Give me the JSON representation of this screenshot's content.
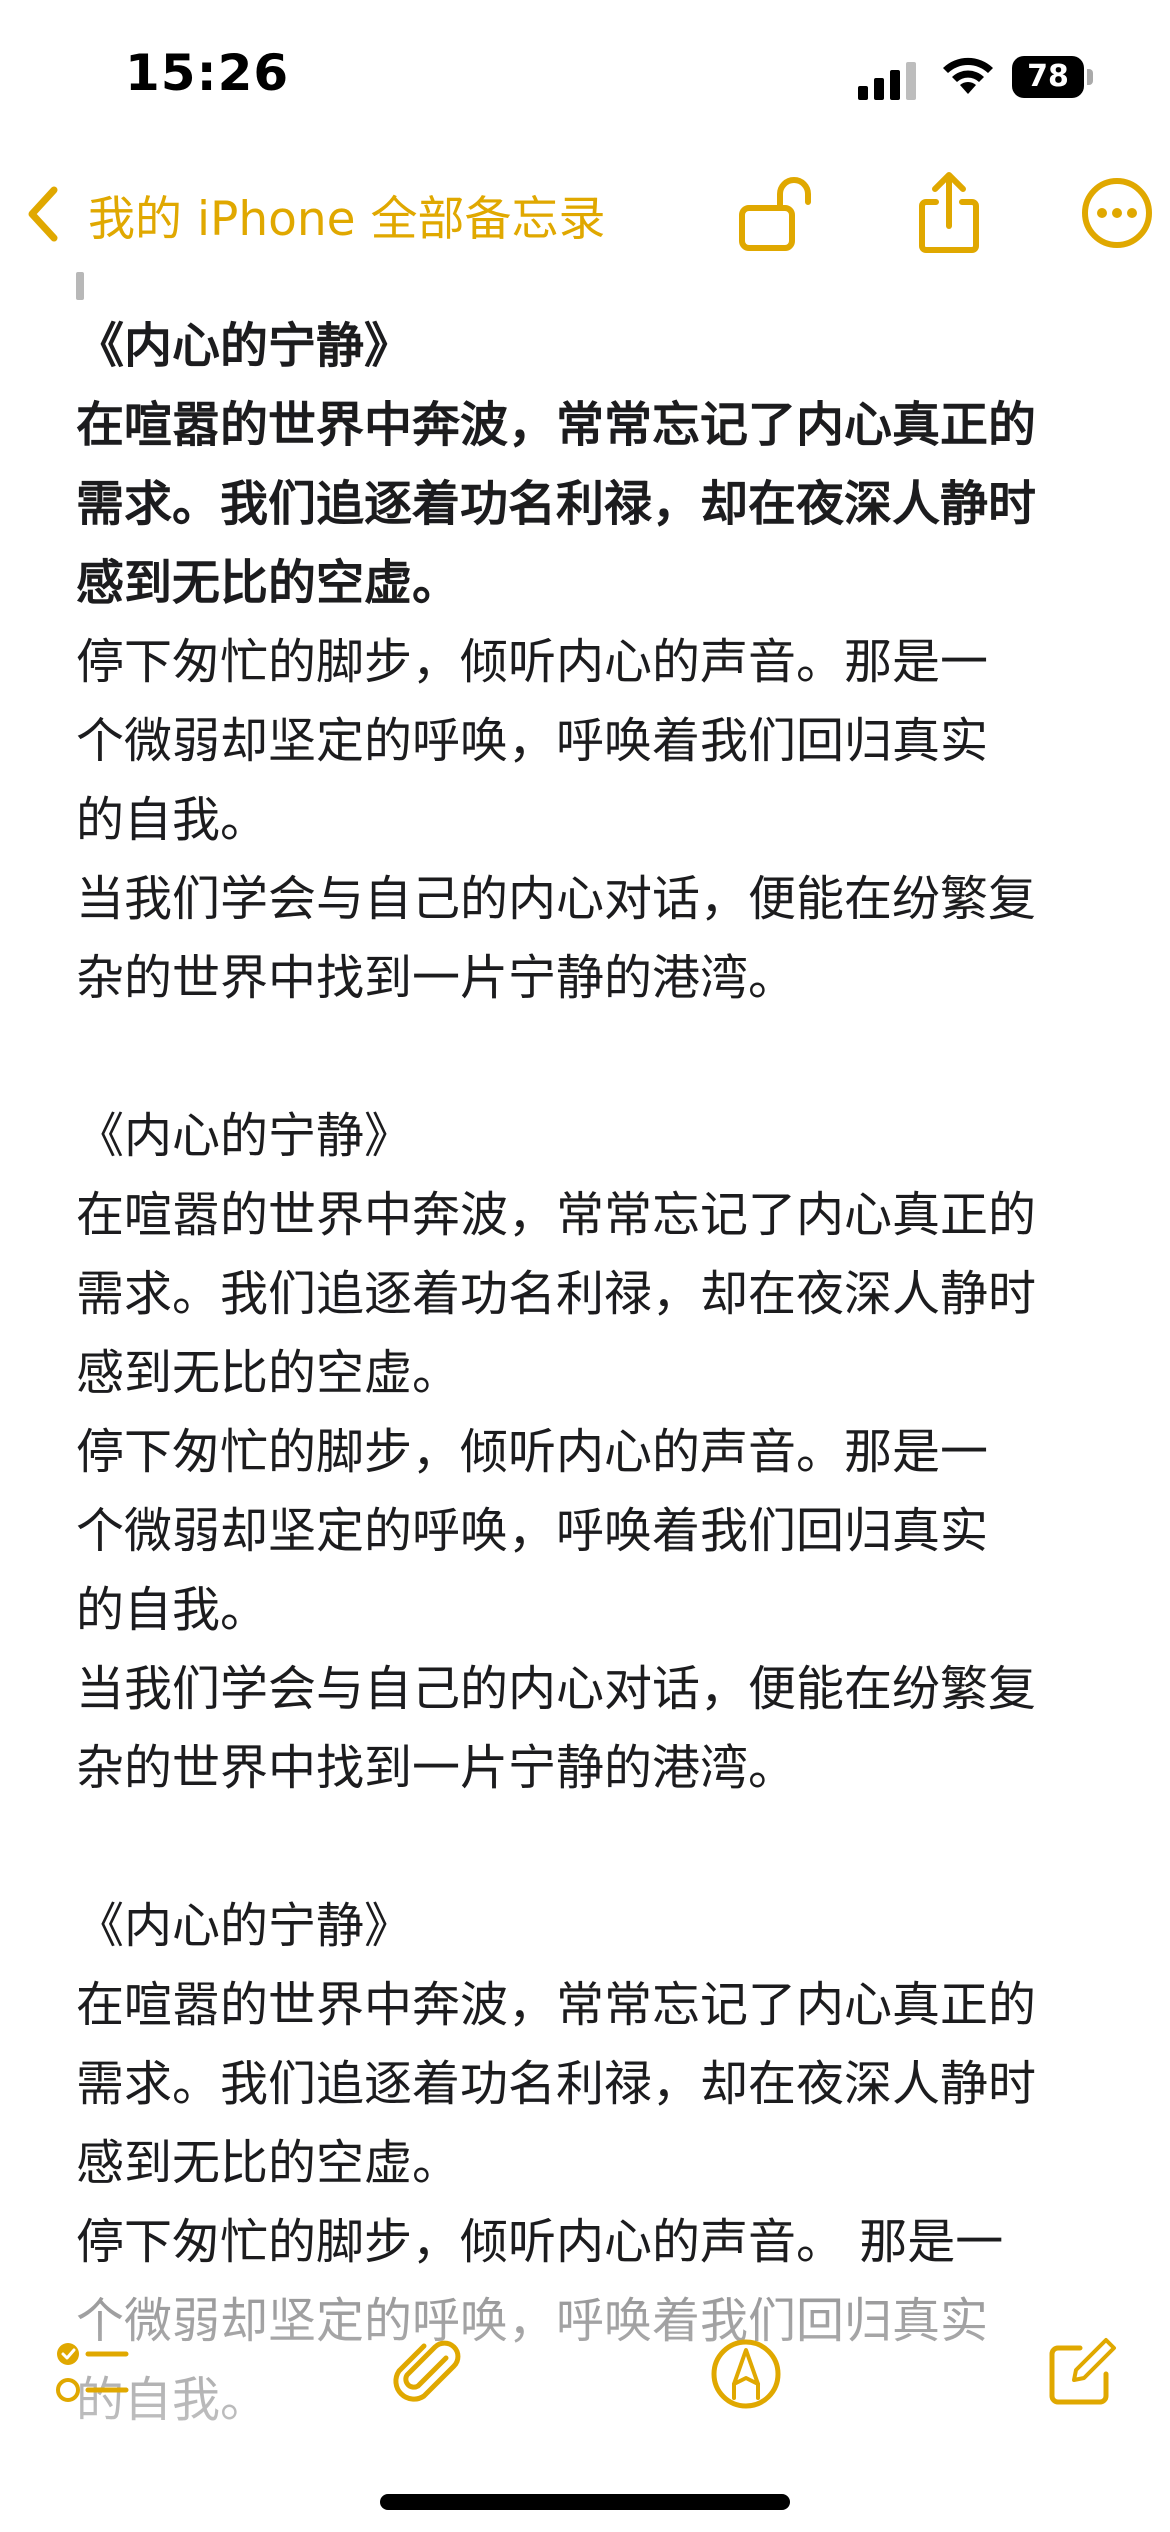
{
  "status_bar": {
    "time": "15:26",
    "battery": "78"
  },
  "nav": {
    "back_label": "我的 iPhone 全部备忘录"
  },
  "note": {
    "blocks": [
      {
        "title": "《内心的宁静》",
        "para1": [
          "在喧嚣的世界中奔波，常常忘记了内心真正的",
          "需求。我们追逐着功名利禄，却在夜深人静时",
          "感到无比的空虚。"
        ],
        "para2": [
          "停下匆忙的脚步，倾听内心的声音。那是一",
          "个微弱却坚定的呼唤，呼唤着我们回归真实",
          "的自我。"
        ],
        "para3": [
          "当我们学会与自己的内心对话，便能在纷繁复",
          "杂的世界中找到一片宁静的港湾。"
        ]
      },
      {
        "title": "《内心的宁静》",
        "para1": [
          "在喧嚣的世界中奔波，常常忘记了内心真正的",
          "需求。我们追逐着功名利禄，却在夜深人静时",
          "感到无比的空虚。"
        ],
        "para2": [
          "停下匆忙的脚步，倾听内心的声音。那是一",
          "个微弱却坚定的呼唤，呼唤着我们回归真实",
          "的自我。"
        ],
        "para3": [
          "当我们学会与自己的内心对话，便能在纷繁复",
          "杂的世界中找到一片宁静的港湾。"
        ]
      },
      {
        "title": "《内心的宁静》",
        "para1": [
          "在喧嚣的世界中奔波，常常忘记了内心真正的",
          "需求。我们追逐着功名利禄，却在夜深人静时",
          "感到无比的空虚。"
        ],
        "para2": [
          "停下匆忙的脚步，倾听内心的声音。 那是一",
          "个微弱却坚定的呼唤，呼唤着我们回归真实",
          "的自我。"
        ]
      }
    ]
  },
  "colors": {
    "accent": "#e0a800",
    "text": "#1c1c1e"
  },
  "icons": {
    "back": "chevron-left-icon",
    "lock": "unlock-icon",
    "share": "share-icon",
    "more": "ellipsis-circle-icon",
    "checklist": "checklist-icon",
    "attach": "paperclip-icon",
    "markup": "pen-circle-icon",
    "compose": "compose-icon"
  }
}
